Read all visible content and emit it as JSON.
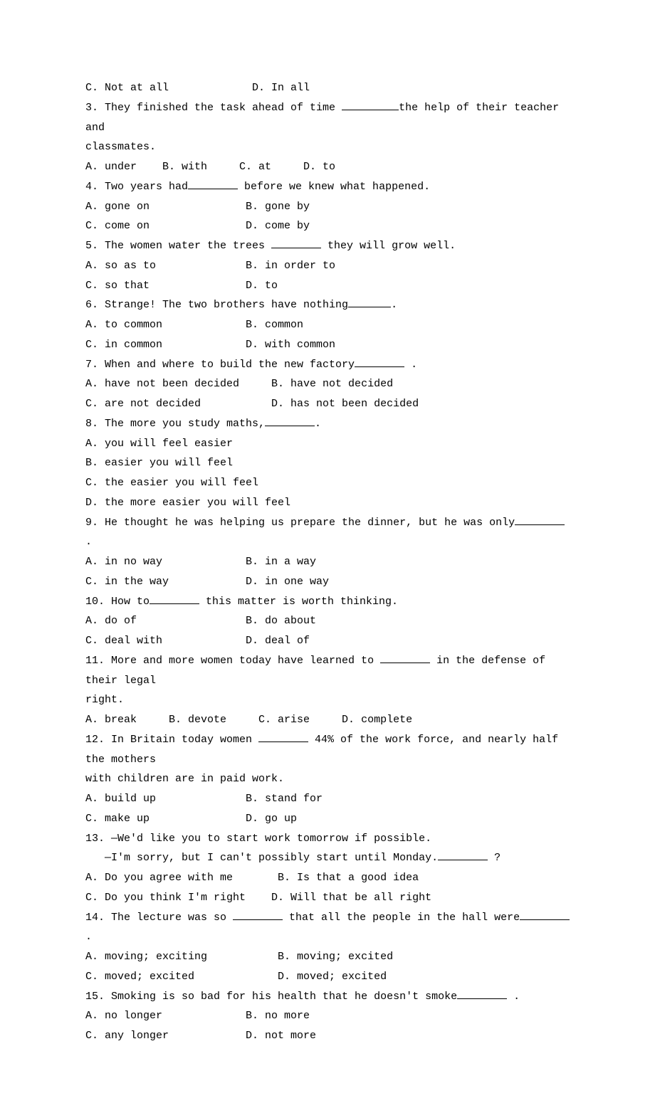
{
  "lines": [
    {
      "before": "C. Not at all             D. In all"
    },
    {
      "before": "3. They finished the task ahead of time ",
      "blank": "w80",
      "after": "the help of their teacher and"
    },
    {
      "before": "classmates."
    },
    {
      "before": "A. under    B. with     C. at     D. to"
    },
    {
      "before": "4. Two years had",
      "blank": "w70",
      "after": " before we knew what happened."
    },
    {
      "before": "A. gone on               B. gone by"
    },
    {
      "before": "C. come on               D. come by"
    },
    {
      "before": "5. The women water the trees ",
      "blank": "w70",
      "after": " they will grow well."
    },
    {
      "before": "A. so as to              B. in order to"
    },
    {
      "before": "C. so that               D. to"
    },
    {
      "before": "6. Strange! The two brothers have nothing",
      "blank": "w60",
      "after": "."
    },
    {
      "before": "A. to common             B. common"
    },
    {
      "before": "C. in common             D. with common"
    },
    {
      "before": "7. When and where to build the new factory",
      "blank": "w70",
      "after": " ."
    },
    {
      "before": "A. have not been decided     B. have not decided"
    },
    {
      "before": "C. are not decided           D. has not been decided"
    },
    {
      "before": "8. The more you study maths,",
      "blank": "w70",
      "after": "."
    },
    {
      "before": "A. you will feel easier"
    },
    {
      "before": "B. easier you will feel"
    },
    {
      "before": "C. the easier you will feel"
    },
    {
      "before": "D. the more easier you will feel"
    },
    {
      "before": "9. He thought he was helping us prepare the dinner, but he was only",
      "blank": "w70",
      "after": " ."
    },
    {
      "before": "A. in no way             B. in a way"
    },
    {
      "before": "C. in the way            D. in one way"
    },
    {
      "before": "10. How to",
      "blank": "w70",
      "after": " this matter is worth thinking."
    },
    {
      "before": "A. do of                 B. do about"
    },
    {
      "before": "C. deal with             D. deal of"
    },
    {
      "before": "11. More and more women today have learned to ",
      "blank": "w70",
      "after": " in the defense of their legal"
    },
    {
      "before": "right."
    },
    {
      "before": "A. break     B. devote     C. arise     D. complete"
    },
    {
      "before": "12. In Britain today women ",
      "blank": "w70",
      "after": " 44% of the work force, and nearly half the mothers"
    },
    {
      "before": "with children are in paid work."
    },
    {
      "before": "A. build up              B. stand for"
    },
    {
      "before": "C. make up               D. go up"
    },
    {
      "before": "13. —We'd like you to start work tomorrow if possible."
    },
    {
      "before": "   —I'm sorry, but I can't possibly start until Monday.",
      "blank": "w70",
      "after": " ?"
    },
    {
      "before": "A. Do you agree with me       B. Is that a good idea"
    },
    {
      "before": "C. Do you think I'm right    D. Will that be all right"
    },
    {
      "before": "14. The lecture was so ",
      "blank": "w70",
      "after": " that all the people in the hall were",
      "blank2": "w70",
      "after2": " ."
    },
    {
      "before": "A. moving; exciting           B. moving; excited"
    },
    {
      "before": "C. moved; excited             D. moved; excited"
    },
    {
      "before": "15. Smoking is so bad for his health that he doesn't smoke",
      "blank": "w70",
      "after": " ."
    },
    {
      "before": "A. no longer             B. no more"
    },
    {
      "before": "C. any longer            D. not more"
    }
  ]
}
